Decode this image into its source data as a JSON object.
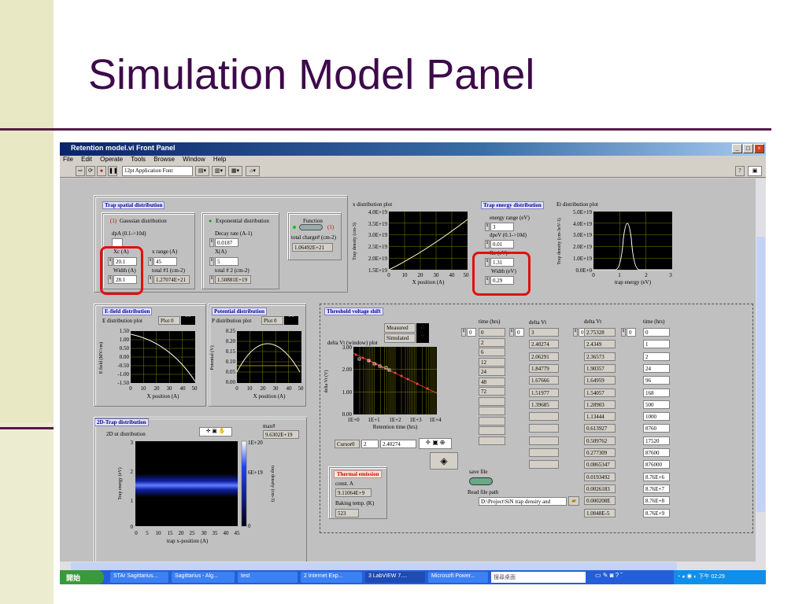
{
  "slide": {
    "title": "Simulation Model Panel"
  },
  "window": {
    "title": "Retention model.vi Front Panel",
    "menu": [
      "File",
      "Edit",
      "Operate",
      "Tools",
      "Browse",
      "Window",
      "Help"
    ],
    "font_select": "12pt Application Font"
  },
  "trap_spatial": {
    "title": "Trap spatial distribution",
    "gaussian_label": "Gaussian distribution",
    "gaussian_led": "(1)",
    "dpa_label": "dpA (0.1->10d)",
    "xc_label": "Xc (A)",
    "xc_value": "20.1",
    "width_label": "Width (A)",
    "width_value": "28.1",
    "xrange_label": "x range (A)",
    "xrange_value": "45",
    "total1_label": "total #1 (cm-2)",
    "total1_value": "1.27074E+21",
    "exp_label": "Exponential distribution",
    "decay_label": "Decay rate (A-1)",
    "decay_value": "0.0187",
    "x_label": "X(A)",
    "x_value": "5",
    "total2_label": "total # 2 (cm-2)",
    "total2_value": "1.50881E+19",
    "function_label": "Function",
    "function_led": "(1)",
    "total_charge_label": "total charge# (cm-2)",
    "total_charge_value": "1.06492E+21"
  },
  "x_plot": {
    "title": "x distribution plot",
    "ylabel": "Trap density (cm-3)",
    "xlabel": "X position (A)",
    "yticks": [
      "4.0E+19",
      "3.5E+19",
      "3.0E+19",
      "2.5E+19",
      "2.0E+19",
      "1.5E+19"
    ],
    "xticks": [
      "0",
      "10",
      "20",
      "30",
      "40",
      "50"
    ]
  },
  "trap_energy": {
    "title": "Trap energy distribution",
    "range_label": "energy range (eV)",
    "range_value": "3",
    "dpev_label": "dpeV (0.1->10d)",
    "dpev_value": "0.01",
    "xc_label": "Xc (eV)",
    "xc_value": "1.31",
    "width_label": "Width (eV)",
    "width_value": "0.29"
  },
  "et_plot": {
    "title": "Et distribution plot",
    "ylabel": "Trap density (cm-3eV-1)",
    "xlabel": "trap energy (eV)",
    "yticks": [
      "5.0E+19",
      "4.0E+19",
      "3.0E+19",
      "2.0E+19",
      "1.0E+19",
      "0.0E+0"
    ],
    "xticks": [
      "0",
      "1",
      "2",
      "3"
    ]
  },
  "efield": {
    "title": "E-field distribution",
    "plot_label": "E distribution plot",
    "legend": "Plot 0",
    "ylabel": "E field (MV/cm)",
    "xlabel": "X position (A)",
    "yticks": [
      "1.50",
      "1.00",
      "0.50",
      "0.00",
      "-0.50",
      "-1.00",
      "-1.50"
    ],
    "xticks": [
      "0",
      "10",
      "20",
      "30",
      "40",
      "50"
    ]
  },
  "potential": {
    "title": "Potential distribution",
    "plot_label": "P distribution plot",
    "legend": "Plot 0",
    "ylabel": "Potential (V)",
    "xlabel": "X position (A)",
    "yticks": [
      "0.25",
      "0.20",
      "0.15",
      "0.10",
      "0.05",
      "0.00"
    ],
    "xticks": [
      "0",
      "10",
      "20",
      "30",
      "40",
      "50"
    ]
  },
  "trap2d": {
    "title": "2D-Trap distribution",
    "plot_label": "2D ut distribution",
    "max_label": "max#",
    "max_value": "9.6302E+19",
    "ylabel": "Trap energy (eV)",
    "xlabel": "trap x-position (A)",
    "zlabel": "trap density (cm-3)",
    "yticks": [
      "3",
      "2",
      "1",
      "0"
    ],
    "xticks": [
      "0",
      "5",
      "10",
      "15",
      "20",
      "25",
      "30",
      "35",
      "40",
      "45"
    ],
    "zticks": [
      "1E+20",
      "6E+19",
      "0"
    ]
  },
  "threshold": {
    "title": "Threshold voltage shift",
    "plot_label": "delta Vt (window) plot",
    "measured": "Measured",
    "simulated": "Simulated",
    "ylabel": "delta Vt (V)",
    "xlabel": "Retention time (hrs)",
    "yticks": [
      "3.00",
      "2.00",
      "1.00",
      "0.00"
    ],
    "xticks": [
      "1E+0",
      "1E+1",
      "1E+2",
      "1E+3",
      "1E+4"
    ],
    "cursor_name": "Cursor0",
    "cursor_x": "2",
    "cursor_y": "2.40274",
    "time_label": "time (hrs)",
    "dvt_label": "delta Vt",
    "dvt2_label": "delta Vt",
    "time2_label": "time (hrs)",
    "idx0": "0",
    "idx1": "0",
    "idx2": "0",
    "idx3": "0",
    "time_col": [
      "0",
      "2",
      "6",
      "12",
      "24",
      "48",
      "72",
      "",
      "",
      "",
      "",
      ""
    ],
    "dvt_col": [
      "3",
      "2.40274",
      "2.06291",
      "1.84779",
      "1.67666",
      "1.51977",
      "1.39685",
      "",
      "",
      "",
      "",
      ""
    ],
    "dvt2_col": [
      "2.75328",
      "2.4349",
      "2.36573",
      "1.90357",
      "1.64959",
      "1.54057",
      "1.28903",
      "1.13444",
      "0.613927",
      "0.509762",
      "0.277309",
      "0.0865347",
      "0.0193492",
      "0.0026183",
      "0.000208E",
      "1.0048E-5"
    ],
    "time2_col": [
      "0",
      "1",
      "2",
      "24",
      "96",
      "168",
      "500",
      "1000",
      "8760",
      "17520",
      "87600",
      "876000",
      "8.76E+6",
      "8.76E+7",
      "8.76E+8",
      "8.76E+9"
    ]
  },
  "thermal": {
    "title": "Thermal emission",
    "const_label": "const. A",
    "const_value": "9.11064E+9",
    "bake_label": "Baking temp. (K)",
    "bake_value": "523"
  },
  "savefile": {
    "label": "save file",
    "path_label": "Read file path",
    "path_value": "D:\\Project\\SiN trap density and"
  },
  "taskbar": {
    "start": "開始",
    "items": [
      "STAr Sagittarius...",
      "Sagittarius - Alg...",
      "test",
      "2 Internet Exp...",
      "3 LabVIEW 7....",
      "Microsoft Power..."
    ],
    "search": "搜尋桌面",
    "clock": "下午 02:29"
  }
}
